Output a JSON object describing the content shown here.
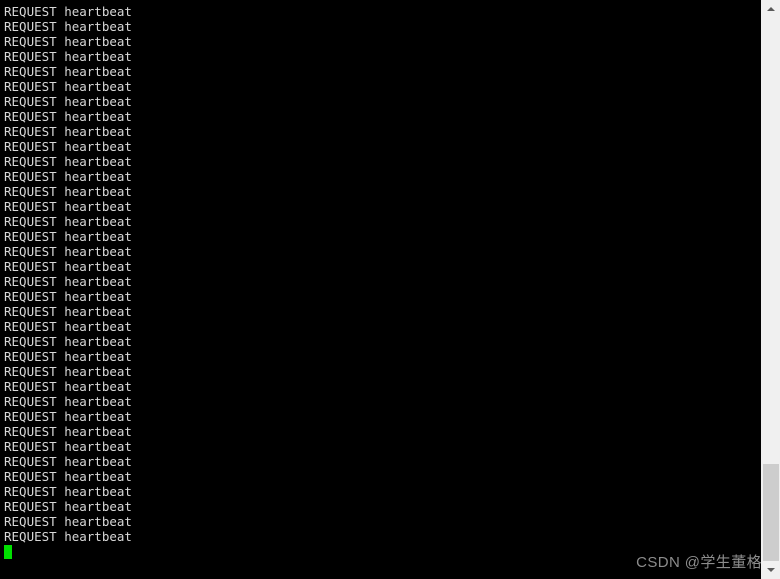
{
  "window": {
    "type": "terminal-console",
    "background_color": "#000000",
    "text_color": "#d8d8d8"
  },
  "terminal": {
    "line_text": "REQUEST heartbeat",
    "line_count": 36,
    "lines": [
      "REQUEST heartbeat",
      "REQUEST heartbeat",
      "REQUEST heartbeat",
      "REQUEST heartbeat",
      "REQUEST heartbeat",
      "REQUEST heartbeat",
      "REQUEST heartbeat",
      "REQUEST heartbeat",
      "REQUEST heartbeat",
      "REQUEST heartbeat",
      "REQUEST heartbeat",
      "REQUEST heartbeat",
      "REQUEST heartbeat",
      "REQUEST heartbeat",
      "REQUEST heartbeat",
      "REQUEST heartbeat",
      "REQUEST heartbeat",
      "REQUEST heartbeat",
      "REQUEST heartbeat",
      "REQUEST heartbeat",
      "REQUEST heartbeat",
      "REQUEST heartbeat",
      "REQUEST heartbeat",
      "REQUEST heartbeat",
      "REQUEST heartbeat",
      "REQUEST heartbeat",
      "REQUEST heartbeat",
      "REQUEST heartbeat",
      "REQUEST heartbeat",
      "REQUEST heartbeat",
      "REQUEST heartbeat",
      "REQUEST heartbeat",
      "REQUEST heartbeat",
      "REQUEST heartbeat",
      "REQUEST heartbeat",
      "REQUEST heartbeat"
    ],
    "cursor": {
      "visible": true,
      "color": "#00e000",
      "shape": "block"
    }
  },
  "watermark": {
    "text": "CSDN @学生董格",
    "color": "#8c8c8c"
  },
  "scrollbar": {
    "orientation": "vertical",
    "up_arrow_icon": "chevron-up-icon",
    "down_arrow_icon": "chevron-down-icon",
    "track_color": "#f0f0f0",
    "thumb_color": "#cdcdcd",
    "thumb_position": "bottom"
  }
}
